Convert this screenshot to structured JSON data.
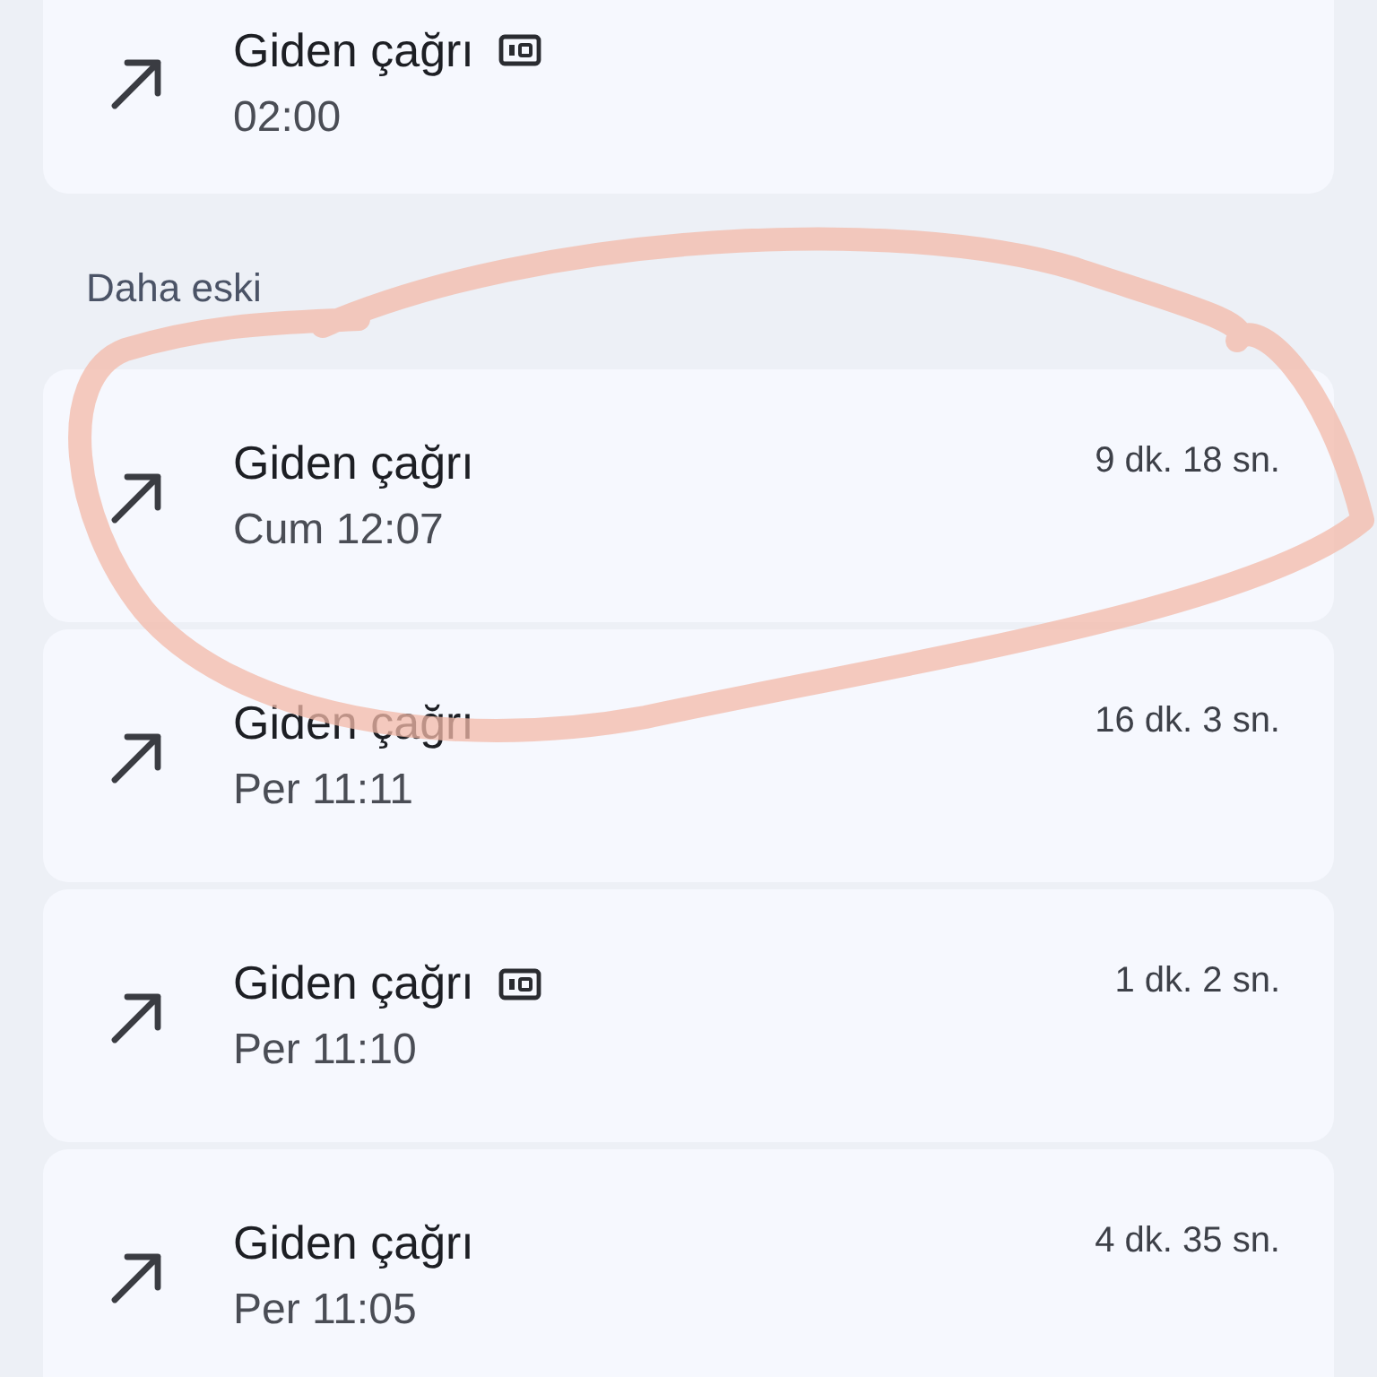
{
  "recent_calls": [
    {
      "title": "Giden çağrı",
      "hd": true,
      "time": "02:00"
    }
  ],
  "sections": [
    {
      "heading": "Daha eski",
      "calls": [
        {
          "title": "Giden çağrı",
          "hd": false,
          "time": "Cum 12:07",
          "duration": "9 dk. 18 sn."
        },
        {
          "title": "Giden çağrı",
          "hd": false,
          "time": "Per 11:11",
          "duration": "16 dk. 3 sn."
        },
        {
          "title": "Giden çağrı",
          "hd": true,
          "time": "Per 11:10",
          "duration": "1 dk. 2 sn."
        },
        {
          "title": "Giden çağrı",
          "hd": false,
          "time": "Per 11:05",
          "duration": "4 dk. 35 sn."
        }
      ]
    }
  ]
}
